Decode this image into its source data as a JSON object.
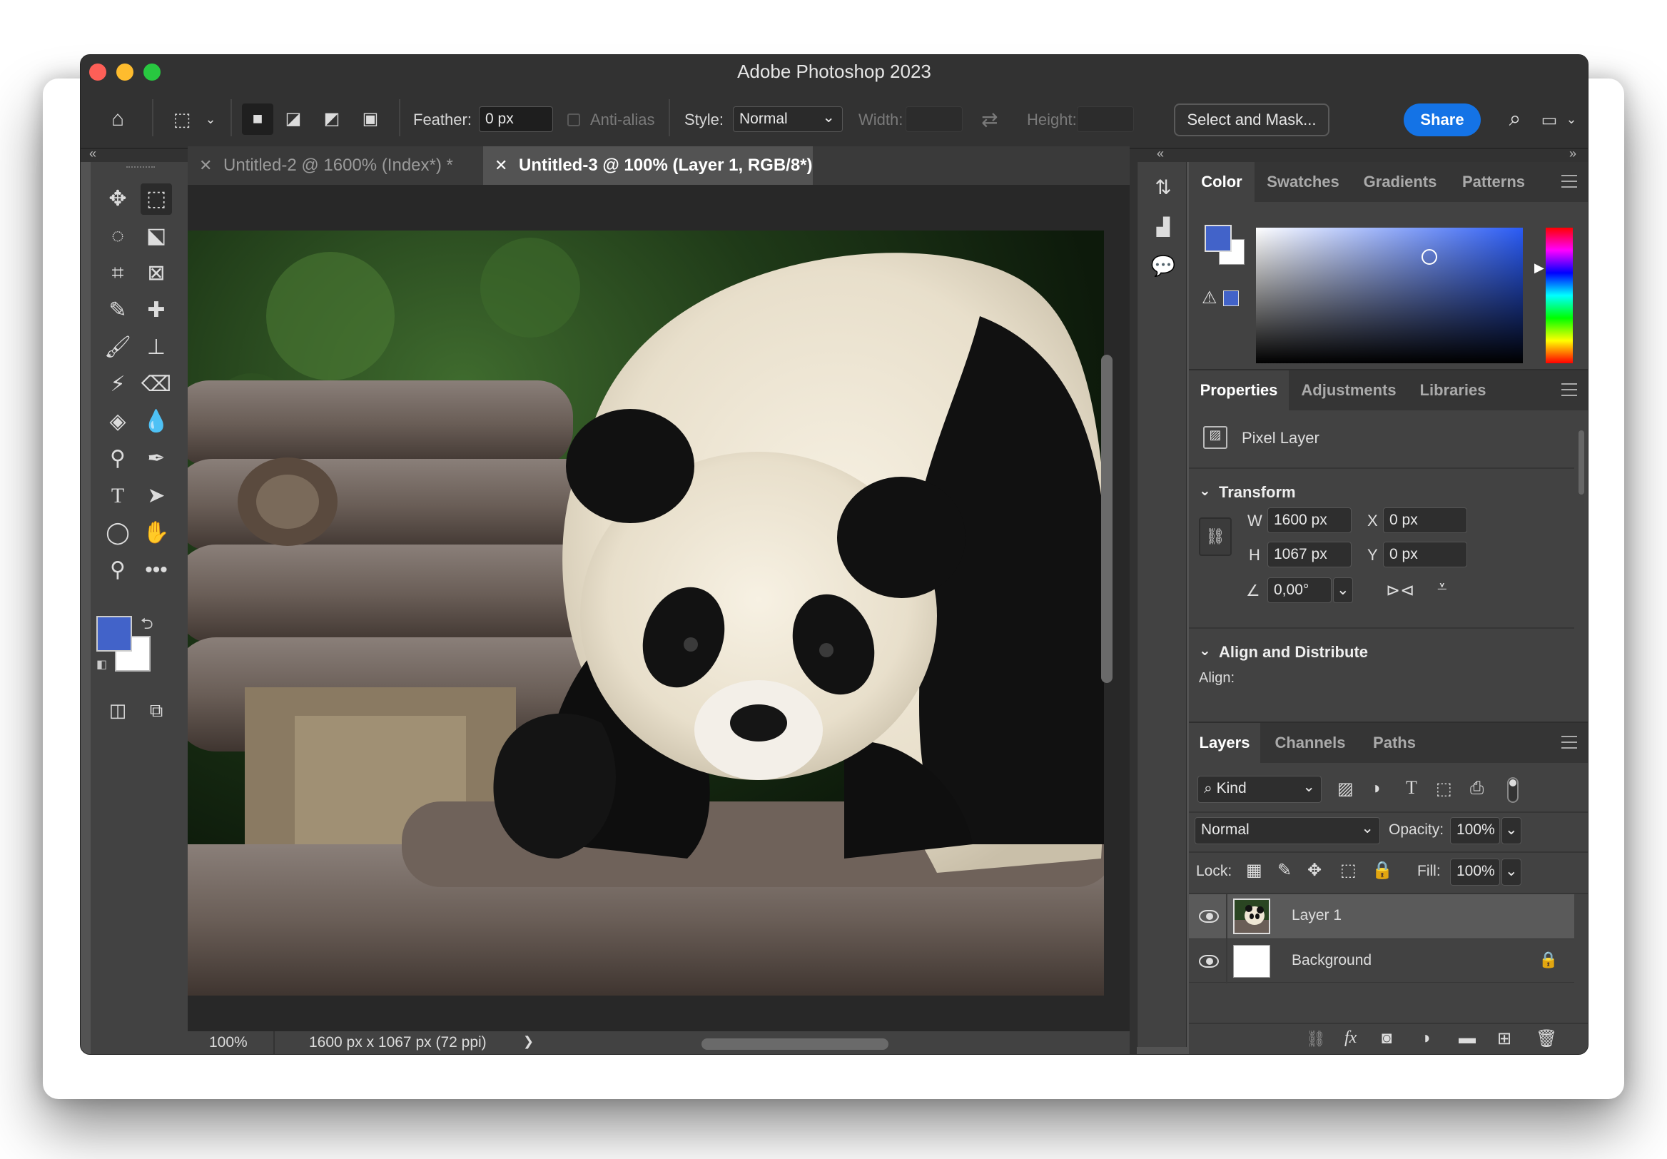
{
  "window": {
    "title": "Adobe Photoshop 2023"
  },
  "options": {
    "feather_label": "Feather:",
    "feather_value": "0 px",
    "antialias_label": "Anti-alias",
    "style_label": "Style:",
    "style_value": "Normal",
    "width_label": "Width:",
    "height_label": "Height:",
    "select_mask_label": "Select and Mask...",
    "share_label": "Share"
  },
  "doc_tabs": [
    {
      "label": "Untitled-2 @ 1600% (Index*) *",
      "active": false
    },
    {
      "label": "Untitled-3 @ 100% (Layer 1, RGB/8*) *",
      "active": true
    }
  ],
  "status": {
    "zoom": "100%",
    "doc_info": "1600 px x 1067 px (72 ppi)",
    "arrow": "❯"
  },
  "colors": {
    "foreground": "#4263c9",
    "background": "#ffffff",
    "accent": "#1473e6"
  },
  "color_panel": {
    "tabs": [
      "Color",
      "Swatches",
      "Gradients",
      "Patterns"
    ]
  },
  "properties_panel": {
    "tabs": [
      "Properties",
      "Adjustments",
      "Libraries"
    ],
    "layer_type": "Pixel Layer",
    "transform_label": "Transform",
    "w_label": "W",
    "w_value": "1600 px",
    "h_label": "H",
    "h_value": "1067 px",
    "x_label": "X",
    "x_value": "0 px",
    "y_label": "Y",
    "y_value": "0 px",
    "angle_value": "0,00°",
    "align_section": "Align and Distribute",
    "align_label": "Align:"
  },
  "layers_panel": {
    "tabs": [
      "Layers",
      "Channels",
      "Paths"
    ],
    "filter_kind": "Kind",
    "blend_mode": "Normal",
    "opacity_label": "Opacity:",
    "opacity_value": "100%",
    "lock_label": "Lock:",
    "fill_label": "Fill:",
    "fill_value": "100%",
    "layers": [
      {
        "name": "Layer 1",
        "selected": true
      },
      {
        "name": "Background",
        "selected": false
      }
    ]
  },
  "icons": [
    "home-icon",
    "marquee-icon",
    "move-icon",
    "lasso-icon",
    "crop-icon",
    "eyedropper-icon",
    "brush-icon",
    "stamp-icon",
    "eraser-icon",
    "bucket-icon",
    "blur-icon",
    "dodge-icon",
    "pen-icon",
    "type-icon",
    "path-select-icon",
    "ellipse-icon",
    "hand-icon",
    "zoom-icon",
    "more-icon",
    "search-icon",
    "eye-icon",
    "lock-icon",
    "trash-icon"
  ]
}
